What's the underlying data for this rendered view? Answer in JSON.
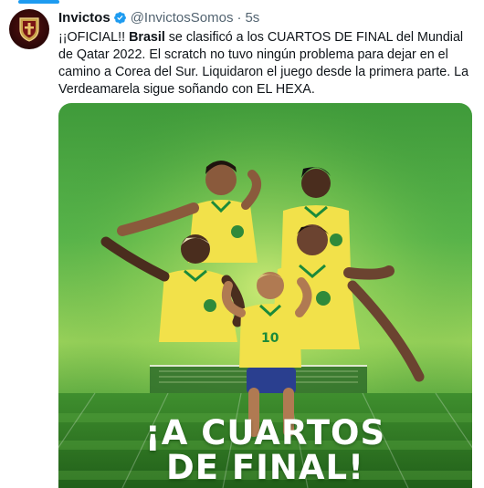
{
  "tweet": {
    "author_name": "Invictos",
    "handle": "@InvictosSomos",
    "separator": "·",
    "time": "5s",
    "text_part1": "¡¡OFICIAL!! ",
    "text_bold": "Brasil",
    "text_part2": " se clasificó a los CUARTOS DE FINAL del Mundial de Qatar 2022. El scratch no tuvo ningún problema para dejar en el camino a Corea del Sur. Liquidaron el juego desde la primera parte. La Verdeamarela sigue soñando con EL HEXA."
  },
  "media": {
    "headline_line1": "¡A CUARTOS",
    "headline_line2": "DE FINAL!",
    "colors": {
      "grass": "#58b44a",
      "jersey_yellow": "#f2e14a",
      "jersey_trim": "#1b8a3a",
      "shorts_blue": "#2a3f8f"
    }
  },
  "icons": {
    "avatar": "club-crest-icon",
    "verified": "verified-badge-icon"
  },
  "colors": {
    "accent": "#1d9bf0",
    "muted": "#536471",
    "text": "#0f1419"
  }
}
